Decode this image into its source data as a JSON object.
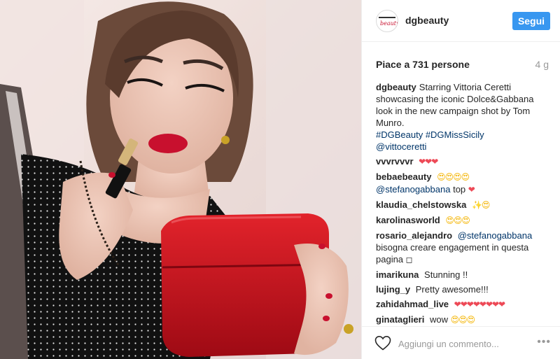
{
  "post": {
    "username": "dgbeauty",
    "follow_label": "Segui",
    "likes": "Piace a 731 persone",
    "time": "4 g",
    "avatar_top": "DOLCE&GABBANA",
    "avatar_script": "beauty"
  },
  "caption": {
    "username": "dgbeauty",
    "text": "Starring Vittoria Ceretti showcasing the iconic Dolce&Gabbana look in the new campaign shot by Tom Munro.",
    "hashtags": "#DGBeauty #DGMissSicily",
    "mention": "@vittoceretti"
  },
  "comments": [
    {
      "username": "vvvrvvvr",
      "emoji": "❤❤❤"
    },
    {
      "username": "bebaebeauty",
      "emoji": "😍😍😍😍",
      "mention": "@stefanogabbana",
      "text": "top",
      "emoji2": "❤"
    },
    {
      "username": "klaudia_chelstowska",
      "emoji": "✨😍"
    },
    {
      "username": "karolinasworld",
      "emoji": "😍😍😍"
    },
    {
      "username": "rosario_alejandro",
      "mention": "@stefanogabbana",
      "text": "bisogna creare engagement in questa pagina",
      "emoji": "◻"
    },
    {
      "username": "imarikuna",
      "text": "Stunning !!"
    },
    {
      "username": "lujing_y",
      "text": "Pretty awesome!!!"
    },
    {
      "username": "zahidahmad_live",
      "emoji": "❤❤❤❤❤❤❤❤"
    },
    {
      "username": "ginataglieri",
      "text": "wow",
      "emoji": "😍😍😍"
    }
  ],
  "footer": {
    "comment_placeholder": "Aggiungi un commento...",
    "more": "•••"
  },
  "colors": {
    "accent": "#3897f0",
    "link": "#003569",
    "heart": "#ed4956",
    "lipstick": "#c8102e"
  },
  "icons": [
    "heart-icon",
    "more-icon"
  ]
}
